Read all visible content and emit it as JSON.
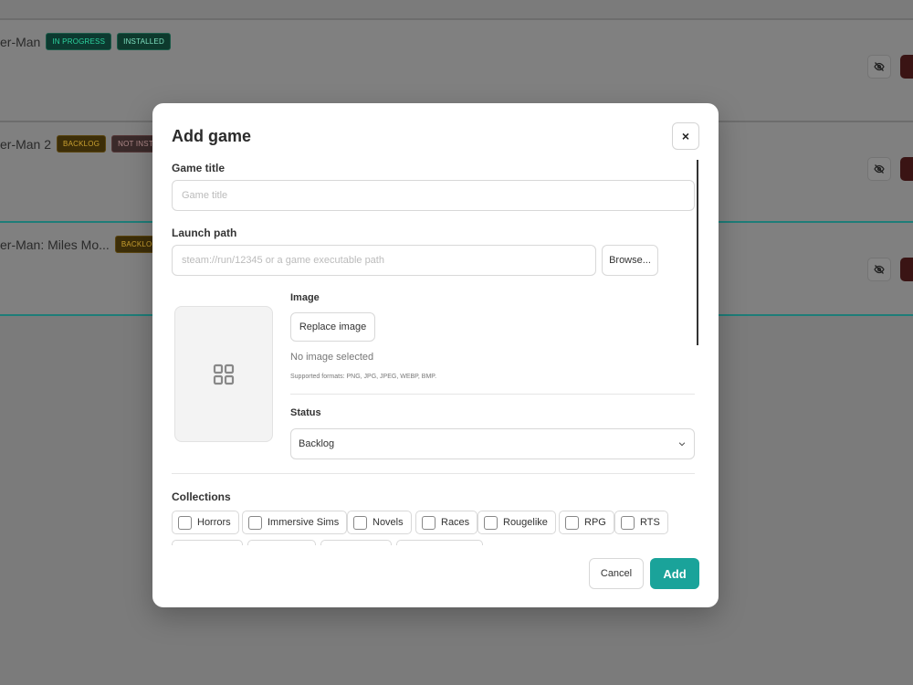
{
  "background_list": {
    "rows": [
      {
        "title": "er-Man",
        "badges": [
          "IN PROGRESS",
          "INSTALLED"
        ]
      },
      {
        "title": "er-Man 2",
        "badges": [
          "BACKLOG",
          "NOT INSTA"
        ]
      },
      {
        "title": "er-Man: Miles Mo...",
        "badges": [
          "BACKLOG"
        ]
      }
    ]
  },
  "modal": {
    "title": "Add game",
    "close_label": "×",
    "game_title_label": "Game title",
    "game_title_placeholder": "Game title",
    "launch_path_label": "Launch path",
    "launch_path_placeholder": "steam://run/12345 or a game executable path",
    "browse_label": "Browse...",
    "image_label": "Image",
    "replace_image_label": "Replace image",
    "no_image_text": "No image selected",
    "supported_formats": "Supported formats: PNG, JPG, JPEG, WEBP, BMP.",
    "status_label": "Status",
    "status_value": "Backlog",
    "collections_label": "Collections",
    "collections": [
      "Horrors",
      "Immersive Sims",
      "Novels",
      "Races",
      "Rougelike",
      "RPG",
      "RTS"
    ],
    "cancel_label": "Cancel",
    "add_label": "Add"
  },
  "colors": {
    "accent": "#1aa39a",
    "overlay": "#7b7b7b"
  }
}
